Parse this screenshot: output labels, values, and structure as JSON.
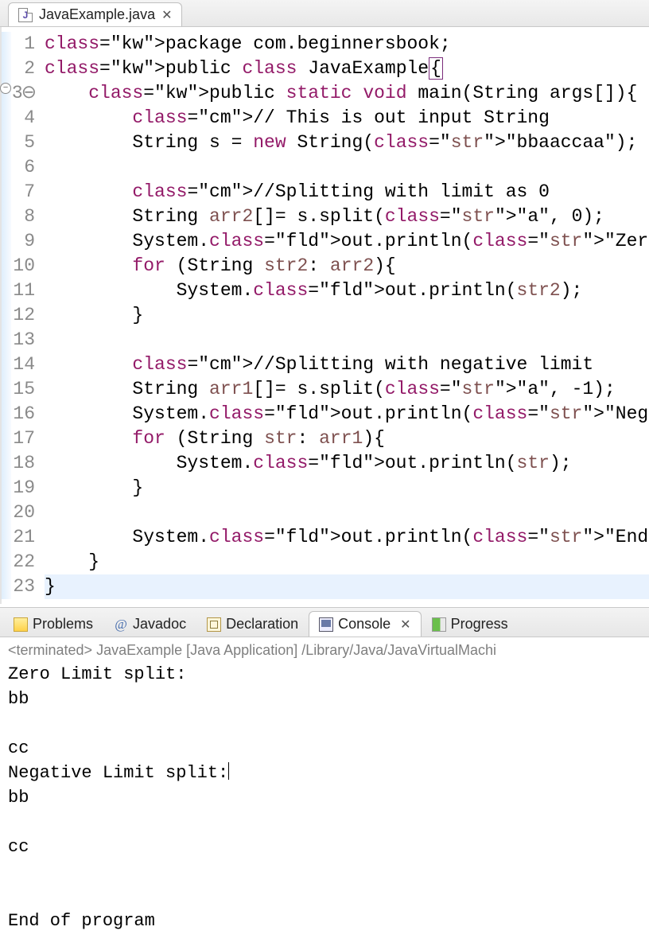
{
  "editor": {
    "tab": {
      "filename": "JavaExample.java",
      "icon_letter": "J"
    },
    "lines": {
      "1": "package com.beginnersbook;",
      "2": "public class JavaExample{",
      "3": "    public static void main(String args[]){",
      "4": "        // This is out input String",
      "5": "        String s = new String(\"bbaaccaa\");",
      "6": "",
      "7": "        //Splitting with limit as 0",
      "8": "        String arr2[]= s.split(\"a\", 0);",
      "9": "        System.out.println(\"Zero Limit split:\");",
      "10": "        for (String str2: arr2){",
      "11": "            System.out.println(str2);",
      "12": "        }",
      "13": "",
      "14": "        //Splitting with negative limit",
      "15": "        String arr1[]= s.split(\"a\", -1);",
      "16": "        System.out.println(\"Negative Limit split:\");",
      "17": "        for (String str: arr1){",
      "18": "            System.out.println(str);",
      "19": "        }",
      "20": "",
      "21": "        System.out.println(\"End of program\");",
      "22": "    }",
      "23": "}"
    },
    "line_count": 23,
    "fold_line": 3
  },
  "panel": {
    "tabs": {
      "problems": "Problems",
      "javadoc": "Javadoc",
      "declaration": "Declaration",
      "console": "Console",
      "progress": "Progress"
    },
    "active": "console"
  },
  "console": {
    "header": "<terminated> JavaExample [Java Application] /Library/Java/JavaVirtualMachi",
    "output": "Zero Limit split:\nbb\n\ncc\nNegative Limit split:\nbb\n\ncc\n\n\nEnd of program"
  }
}
